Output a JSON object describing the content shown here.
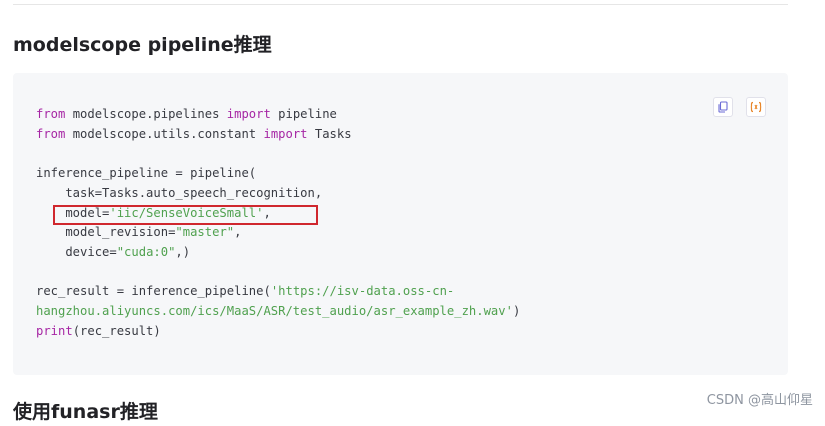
{
  "article": {
    "section_heading": "modelscope pipeline推理",
    "next_heading": "使用funasr推理"
  },
  "code": {
    "line1": {
      "kw_from": "from",
      "module": " modelscope.pipelines ",
      "kw_import": "import",
      "name": " pipeline"
    },
    "line2": {
      "kw_from": "from",
      "module": " modelscope.utils.constant ",
      "kw_import": "import",
      "name": " Tasks"
    },
    "line4": "inference_pipeline = pipeline(",
    "line5": "    task=Tasks.auto_speech_recognition,",
    "line6": {
      "prefix": "    model=",
      "value": "'iic/SenseVoiceSmall'",
      "suffix": ","
    },
    "line7": {
      "prefix": "    model_revision=",
      "value": "\"master\"",
      "suffix": ","
    },
    "line8": {
      "prefix": "    device=",
      "value": "\"cuda:0\"",
      "suffix": ",)"
    },
    "line10": {
      "prefix": "rec_result = inference_pipeline(",
      "value": "'https://isv-data.oss-cn-"
    },
    "line11": {
      "value": "hangzhou.aliyuncs.com/ics/MaaS/ASR/test_audio/asr_example_zh.wav'",
      "suffix": ")"
    },
    "line12": {
      "kw_print": "print",
      "rest": "(rec_result)"
    }
  },
  "colors": {
    "keyword": "#a626a4",
    "string": "#50a14f",
    "highlight_border": "#d0272e",
    "code_background": "#f6f7f9"
  },
  "toolbar": {
    "copy_icon": "copy-icon",
    "ai_icon": "ai-assist-icon"
  },
  "watermark": {
    "text": "CSDN @高山仰星"
  }
}
